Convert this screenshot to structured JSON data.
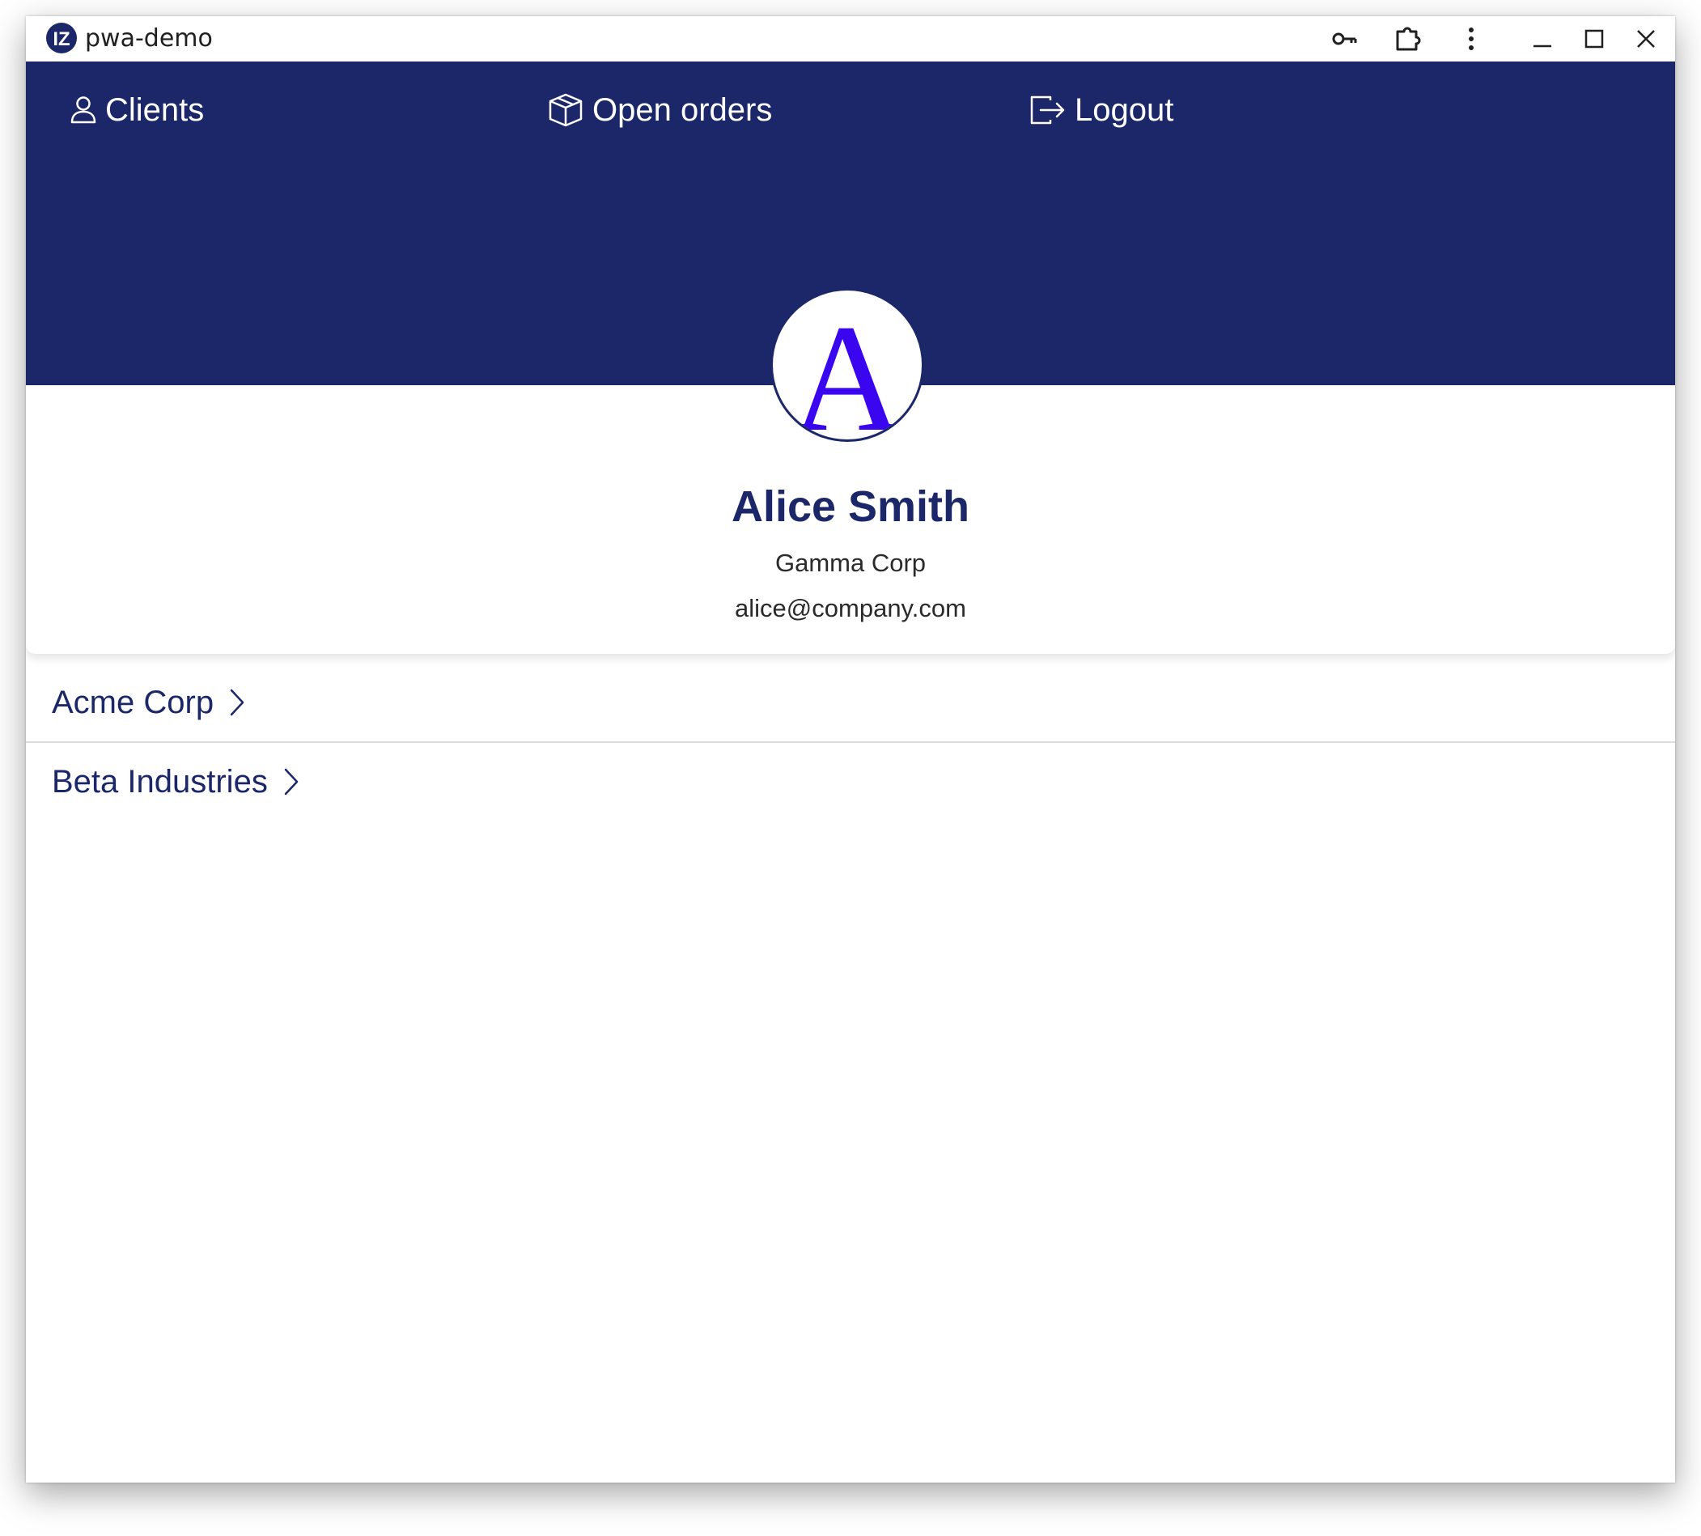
{
  "window": {
    "title": "pwa-demo",
    "logo_icon": "app-logo-icon",
    "controls": [
      "key-icon",
      "extension-icon",
      "more-vert-icon",
      "minimize-icon",
      "maximize-icon",
      "close-icon"
    ]
  },
  "nav": {
    "clients_label": "Clients",
    "open_orders_label": "Open orders",
    "logout_label": "Logout"
  },
  "profile": {
    "avatar_letter": "A",
    "name": "Alice Smith",
    "company": "Gamma Corp",
    "email": "alice@company.com"
  },
  "clients": [
    {
      "name": "Acme Corp"
    },
    {
      "name": "Beta Industries"
    }
  ],
  "colors": {
    "brand_navy": "#1b2769",
    "avatar_letter": "#3a06f0"
  }
}
